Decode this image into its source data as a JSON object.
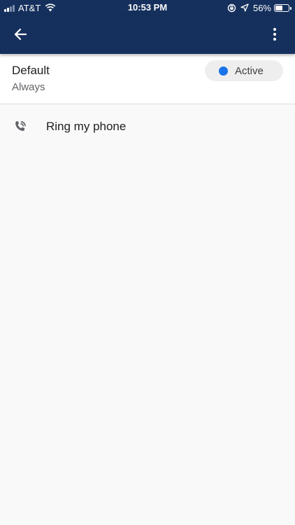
{
  "status_bar": {
    "carrier": "AT&T",
    "time": "10:53 PM",
    "battery_percent": "56%",
    "battery_level": 0.56,
    "signal_bars_filled": 2,
    "signal_bars_total": 4,
    "icons": [
      "signal-icon",
      "wifi-icon",
      "orientation-lock-icon",
      "location-arrow-icon",
      "battery-icon"
    ]
  },
  "app_bar": {
    "background_color": "#15305c",
    "back_icon": "arrow-back-icon",
    "menu_icon": "more-vert-icon"
  },
  "profile": {
    "name": "Default",
    "schedule": "Always",
    "status_label": "Active",
    "status_color": "#1a73e8"
  },
  "items": [
    {
      "icon": "phone-ring-icon",
      "label": "Ring my phone"
    }
  ]
}
